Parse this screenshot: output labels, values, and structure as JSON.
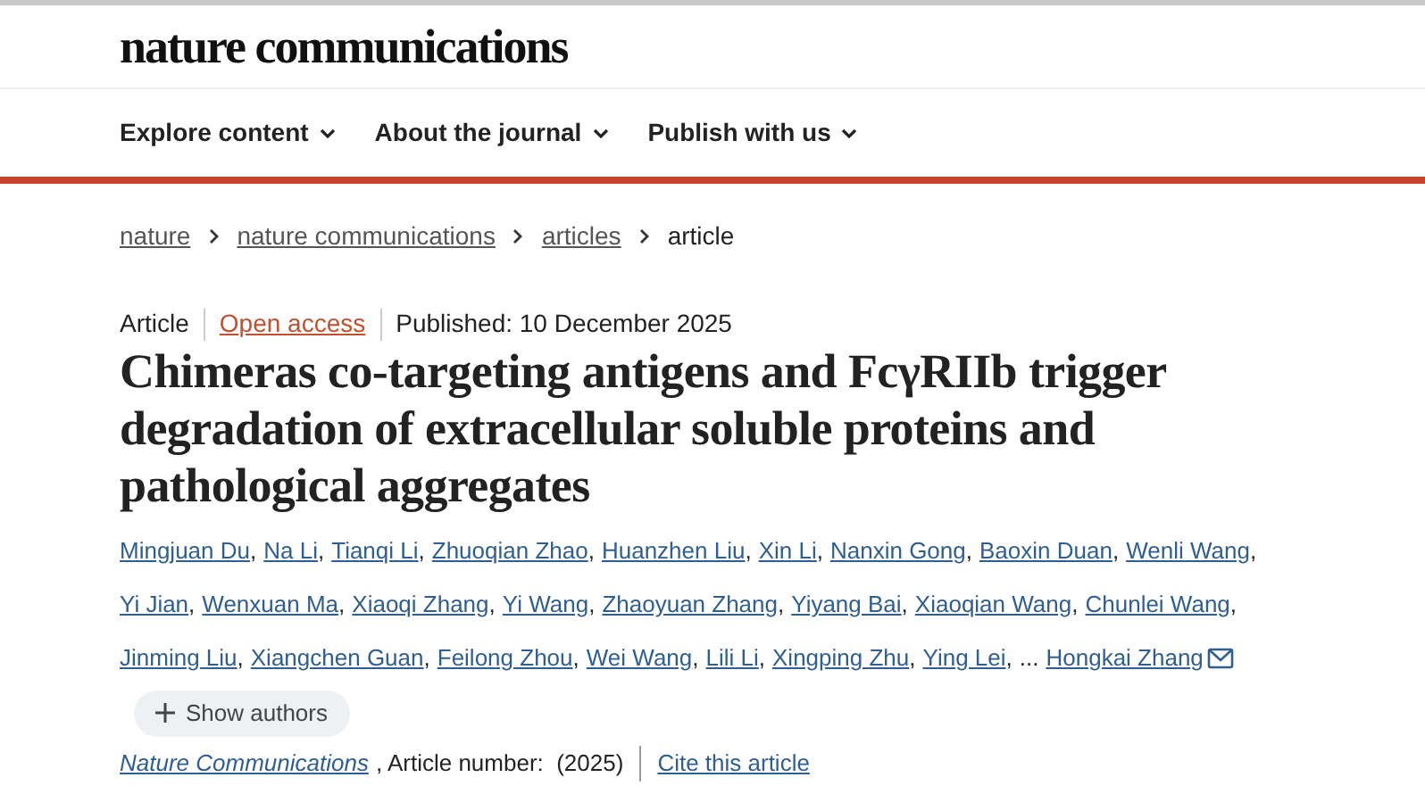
{
  "site": {
    "logo": "nature communications"
  },
  "nav": [
    {
      "label": "Explore content"
    },
    {
      "label": "About the journal"
    },
    {
      "label": "Publish with us"
    }
  ],
  "breadcrumbs": [
    {
      "label": "nature",
      "link": true
    },
    {
      "label": "nature communications",
      "link": true
    },
    {
      "label": "articles",
      "link": true
    },
    {
      "label": "article",
      "link": false
    }
  ],
  "meta": {
    "type": "Article",
    "access": "Open access",
    "published": "Published: 10 December 2025"
  },
  "title": "Chimeras co-targeting antigens and FcγRIIb trigger degradation of extracellular soluble proteins and pathological aggregates",
  "authors": [
    {
      "kind": "author",
      "name": "Mingjuan Du",
      "separator": ","
    },
    {
      "kind": "author",
      "name": "Na Li",
      "separator": ","
    },
    {
      "kind": "author",
      "name": "Tianqi Li",
      "separator": ","
    },
    {
      "kind": "author",
      "name": "Zhuoqian Zhao",
      "separator": ","
    },
    {
      "kind": "author",
      "name": "Huanzhen Liu",
      "separator": ","
    },
    {
      "kind": "author",
      "name": "Xin Li",
      "separator": ","
    },
    {
      "kind": "author",
      "name": "Nanxin Gong",
      "separator": ","
    },
    {
      "kind": "author",
      "name": "Baoxin Duan",
      "separator": ","
    },
    {
      "kind": "author",
      "name": "Wenli Wang",
      "separator": ","
    },
    {
      "kind": "author",
      "name": "Yi Jian",
      "separator": ","
    },
    {
      "kind": "author",
      "name": "Wenxuan Ma",
      "separator": ","
    },
    {
      "kind": "author",
      "name": "Xiaoqi Zhang",
      "separator": ","
    },
    {
      "kind": "author",
      "name": "Yi Wang",
      "separator": ","
    },
    {
      "kind": "author",
      "name": "Zhaoyuan Zhang",
      "separator": ","
    },
    {
      "kind": "author",
      "name": "Yiyang Bai",
      "separator": ","
    },
    {
      "kind": "author",
      "name": "Xiaoqian Wang",
      "separator": ","
    },
    {
      "kind": "author",
      "name": "Chunlei Wang",
      "separator": ","
    },
    {
      "kind": "author",
      "name": "Jinming Liu",
      "separator": ","
    },
    {
      "kind": "author",
      "name": "Xiangchen Guan",
      "separator": ","
    },
    {
      "kind": "author",
      "name": "Feilong Zhou",
      "separator": ","
    },
    {
      "kind": "author",
      "name": "Wei Wang",
      "separator": ","
    },
    {
      "kind": "author",
      "name": "Lili Li",
      "separator": ","
    },
    {
      "kind": "author",
      "name": "Xingping Zhu",
      "separator": ","
    },
    {
      "kind": "author",
      "name": "Ying Lei",
      "separator": ","
    },
    {
      "kind": "ellipsis",
      "name": "..."
    },
    {
      "kind": "author",
      "name": "Hongkai Zhang",
      "email": true
    }
  ],
  "show_authors": {
    "label": "Show authors"
  },
  "citation": {
    "journal": "Nature Communications",
    "details": ", Article number:  (2025)",
    "cite_link": "Cite this article"
  }
}
